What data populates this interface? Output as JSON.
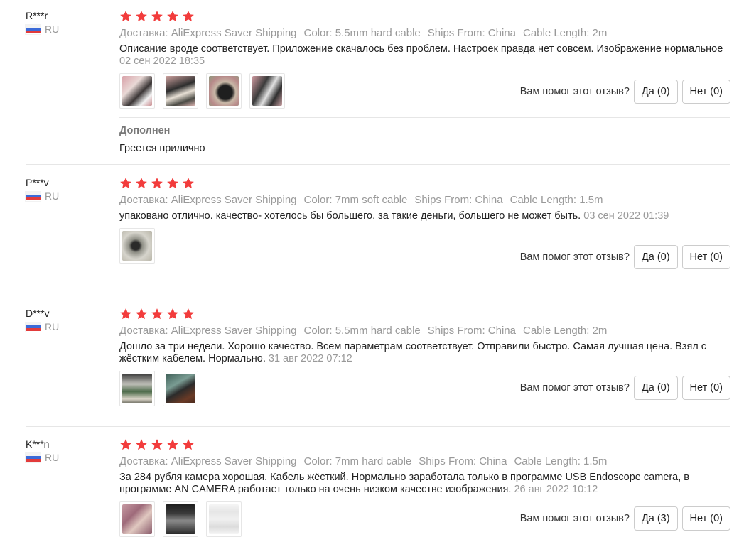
{
  "helpful_question": "Вам помог этот отзыв?",
  "added_label": "Дополнен",
  "star_color": "#f23c3c",
  "reviews": [
    {
      "user": "R***r",
      "country": "RU",
      "rating": 5,
      "shipping": "Доставка: AliExpress Saver Shipping",
      "color": "Color: 5.5mm hard cable",
      "ships_from": "Ships From: China",
      "cable_length": "Cable Length: 2m",
      "text": "Описание вроде соответствует. Приложение скачалось без проблем. Настроек правда нет совсем. Изображение нормальное",
      "date": "02 сен 2022 18:35",
      "yes": "Да (0)",
      "no": "Нет (0)",
      "added_text": "Греется прилично"
    },
    {
      "user": "P***v",
      "country": "RU",
      "rating": 5,
      "shipping": "Доставка: AliExpress Saver Shipping",
      "color": "Color: 7mm soft cable",
      "ships_from": "Ships From: China",
      "cable_length": "Cable Length: 1.5m",
      "text": "упаковано отлично. качество- хотелось бы большего. за такие деньги, большего не может быть.",
      "date": "03 сен 2022 01:39",
      "yes": "Да (0)",
      "no": "Нет (0)"
    },
    {
      "user": "D***v",
      "country": "RU",
      "rating": 5,
      "shipping": "Доставка: AliExpress Saver Shipping",
      "color": "Color: 5.5mm hard cable",
      "ships_from": "Ships From: China",
      "cable_length": "Cable Length: 2m",
      "text": "Дошло за три недели. Хорошо качество. Всем параметрам соответствует. Отправили быстро. Самая лучшая цена. Взял с жёстким кабелем. Нормально.",
      "date": "31 авг 2022 07:12",
      "yes": "Да (0)",
      "no": "Нет (0)"
    },
    {
      "user": "K***n",
      "country": "RU",
      "rating": 5,
      "shipping": "Доставка: AliExpress Saver Shipping",
      "color": "Color: 7mm hard cable",
      "ships_from": "Ships From: China",
      "cable_length": "Cable Length: 1.5m",
      "text": "За 284 рубля камера хорошая. Кабель жёсткий. Нормально заработала только в программе USB Endoscope camera, в программе AN CAMERA работает только на очень низком качестве изображения.",
      "date": "26 авг 2022 10:12",
      "yes": "Да (3)",
      "no": "Нет (0)"
    }
  ]
}
